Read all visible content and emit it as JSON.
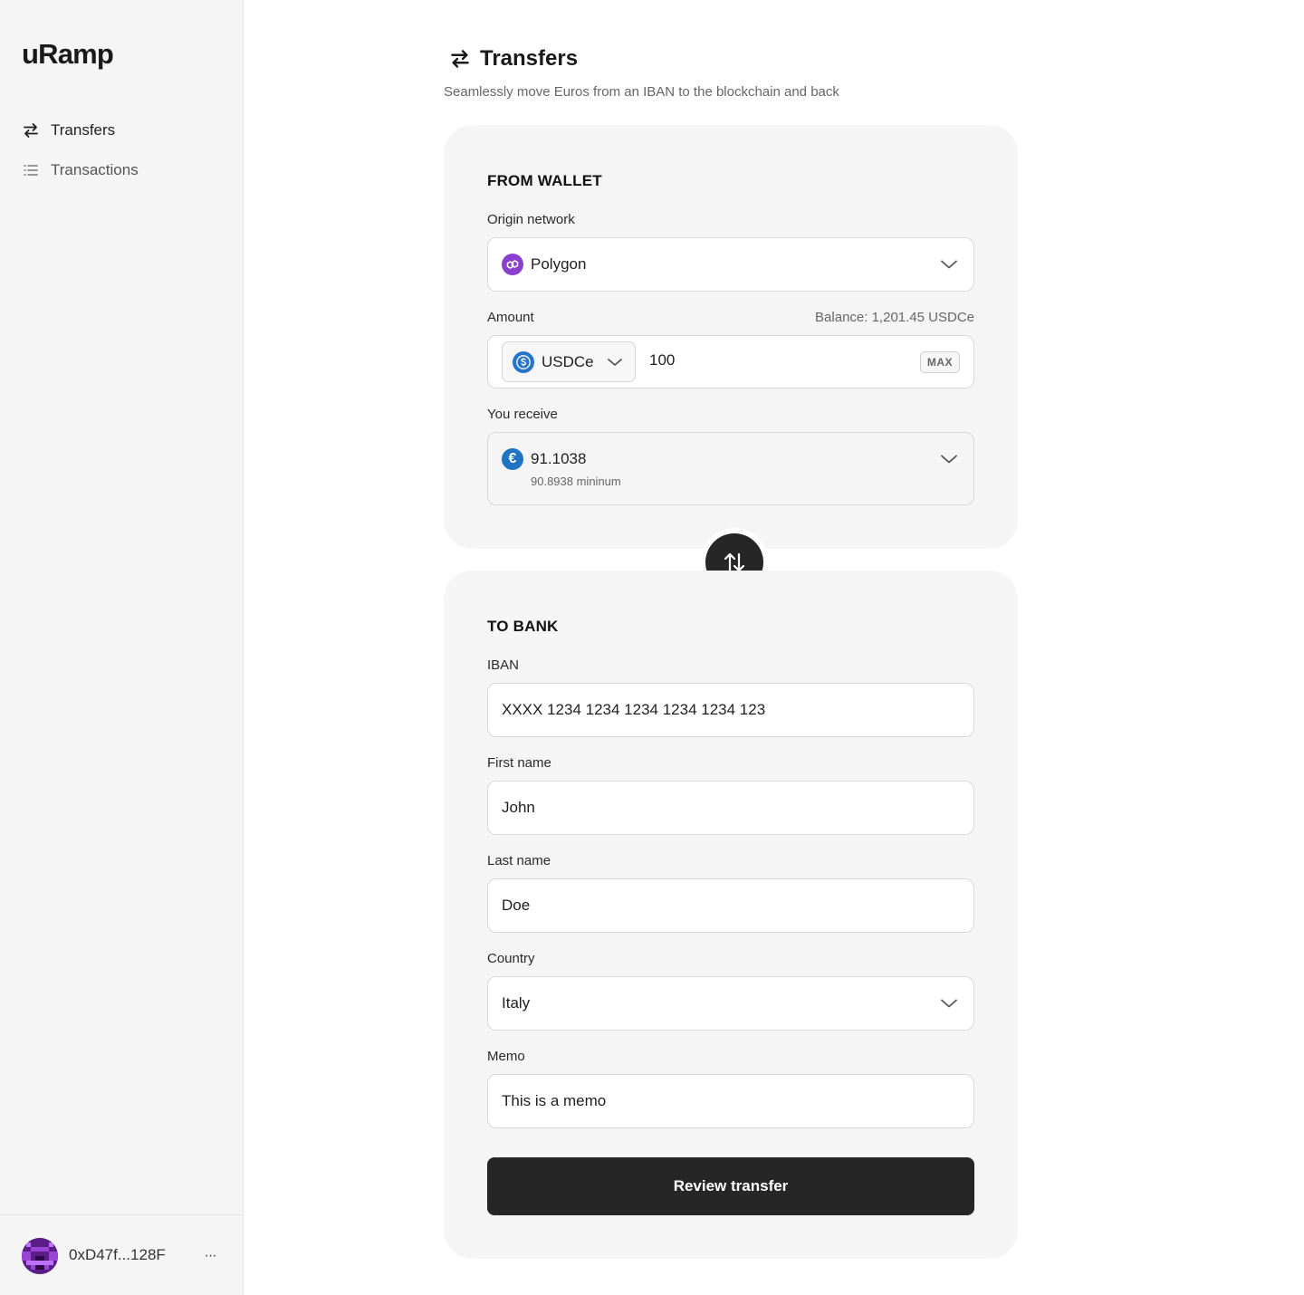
{
  "app": {
    "logo": "uRamp"
  },
  "sidebar": {
    "items": [
      {
        "label": "Transfers",
        "icon": "arrows-left-right-icon",
        "active": true
      },
      {
        "label": "Transactions",
        "icon": "list-icon",
        "active": false
      }
    ],
    "footer": {
      "wallet_address": "0xD47f...128F",
      "more_label": "···"
    }
  },
  "page": {
    "title": "Transfers",
    "subtitle": "Seamlessly move Euros from an IBAN to the blockchain and back"
  },
  "from_wallet": {
    "section_title": "FROM WALLET",
    "origin_network_label": "Origin network",
    "origin_network_value": "Polygon",
    "amount_label": "Amount",
    "balance": "Balance: 1,201.45 USDCe",
    "token": "USDCe",
    "amount_value": "100",
    "max_label": "MAX",
    "receive_label": "You receive",
    "receive_value": "91.1038",
    "receive_minimum": "90.8938 mininum"
  },
  "to_bank": {
    "section_title": "TO BANK",
    "iban_label": "IBAN",
    "iban_value": "XXXX 1234 1234 1234 1234 1234 123",
    "first_name_label": "First name",
    "first_name_value": "John",
    "last_name_label": "Last name",
    "last_name_value": "Doe",
    "country_label": "Country",
    "country_value": "Italy",
    "memo_label": "Memo",
    "memo_value": "This is a memo",
    "submit_label": "Review transfer"
  },
  "colors": {
    "sidebar_bg": "#f5f5f5",
    "card_bg": "#f5f5f5",
    "primary_button": "#262626",
    "polygon": "#8a3fcf",
    "usdc": "#2775ca",
    "euro": "#1f74c4"
  }
}
